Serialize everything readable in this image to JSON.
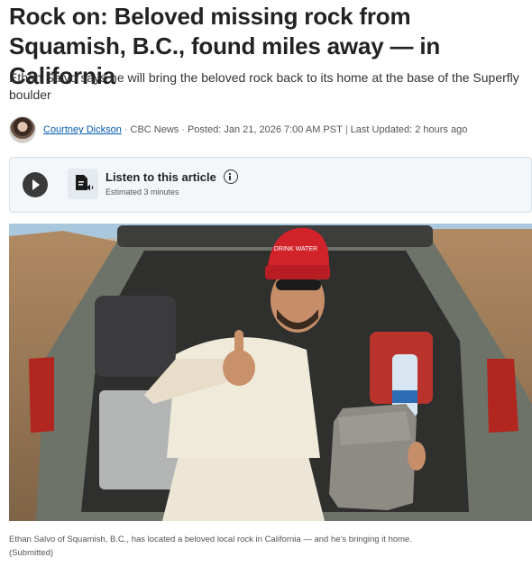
{
  "article": {
    "headline": "Rock on: Beloved missing rock from Squamish, B.C., found miles away — in California",
    "deck": "Ethan Salvo says he will bring the beloved rock back to its home at the base of the Superfly boulder"
  },
  "byline": {
    "author": "Courtney Dickson",
    "outlet": "CBC News",
    "posted": "Posted: Jan 21, 2026 7:00 AM PST",
    "updated": "Last Updated: 2 hours ago"
  },
  "audio": {
    "title": "Listen to this article",
    "estimate": "Estimated 3 minutes"
  },
  "photo": {
    "hat_text": "DRINK WATER"
  },
  "caption": {
    "text": "Ethan Salvo of Squamish, B.C., has located a beloved local rock in California — and he's bringing it home.",
    "credit": "(Submitted)"
  },
  "colors": {
    "link": "#0059b3",
    "headline": "#222222"
  }
}
